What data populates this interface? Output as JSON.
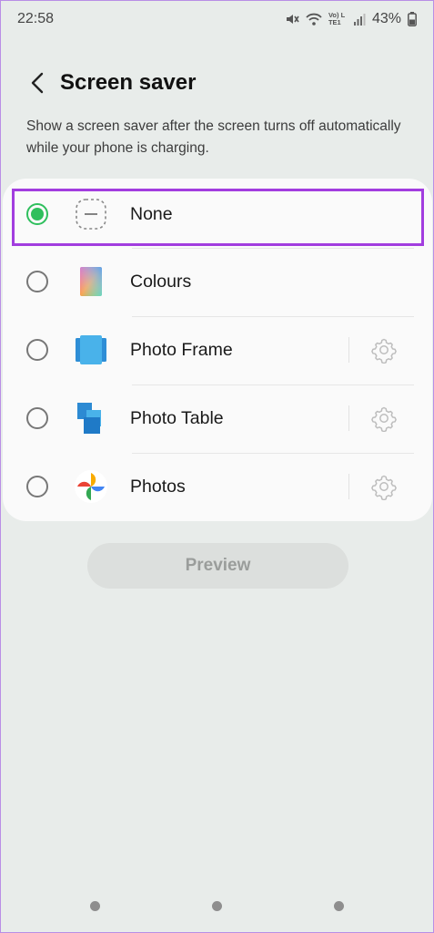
{
  "status_bar": {
    "time": "22:58",
    "battery": "43%",
    "icons": [
      "mute-icon",
      "wifi-icon",
      "volte-lte-icon",
      "signal-icon",
      "battery-icon"
    ],
    "volte_text": "Vo) LTE1"
  },
  "header": {
    "title": "Screen saver",
    "back_icon": "back-arrow-icon"
  },
  "description": "Show a screen saver after the screen turns off automatically while your phone is charging.",
  "options": [
    {
      "label": "None",
      "icon": "none-icon",
      "selected": true,
      "has_settings": false
    },
    {
      "label": "Colours",
      "icon": "colours-icon",
      "selected": false,
      "has_settings": false
    },
    {
      "label": "Photo Frame",
      "icon": "photo-frame-icon",
      "selected": false,
      "has_settings": true
    },
    {
      "label": "Photo Table",
      "icon": "photo-table-icon",
      "selected": false,
      "has_settings": true
    },
    {
      "label": "Photos",
      "icon": "google-photos-icon",
      "selected": false,
      "has_settings": true
    }
  ],
  "preview_button": {
    "label": "Preview",
    "enabled": false
  },
  "colors": {
    "accent_green": "#2fbf5d",
    "highlight_purple": "#a23ddf",
    "background": "#e8ecea",
    "card": "#fafafa"
  }
}
